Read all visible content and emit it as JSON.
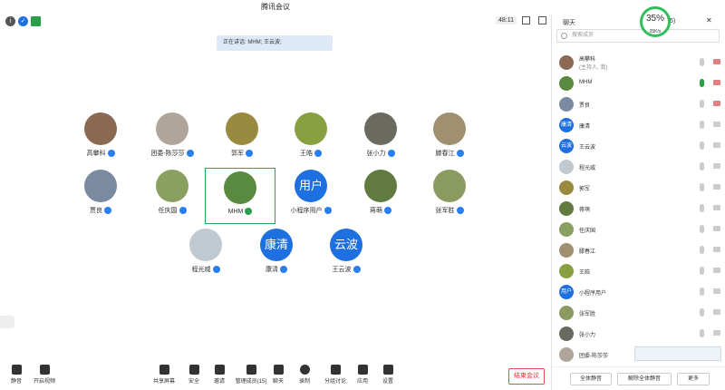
{
  "window": {
    "title": "腾讯会议",
    "timer": "48:11"
  },
  "speaking": "正在讲话: MHM; 王云波;",
  "participants_grid": [
    {
      "name": "高攀科",
      "avatar": "photo",
      "color": "#8a6a52"
    },
    {
      "name": "团委-陈莎莎",
      "avatar": "photo",
      "color": "#b0a59a"
    },
    {
      "name": "郭军",
      "avatar": "photo",
      "color": "#9a8a40"
    },
    {
      "name": "王皓",
      "avatar": "photo",
      "color": "#88a040"
    },
    {
      "name": "张小力",
      "avatar": "photo",
      "color": "#6a6a60"
    },
    {
      "name": "滕春江",
      "avatar": "photo",
      "color": "#a09070"
    },
    {
      "name": "贾良",
      "avatar": "photo",
      "color": "#7a8aa0"
    },
    {
      "name": "任庆国",
      "avatar": "photo",
      "color": "#8aa060"
    },
    {
      "name": "MHM",
      "avatar": "photo",
      "color": "#5a8a40"
    },
    {
      "name": "小程序用户",
      "avatar": "用户",
      "color": "#1e6fe0"
    },
    {
      "name": "蒋萌",
      "avatar": "photo",
      "color": "#607a40"
    },
    {
      "name": "张军胜",
      "avatar": "photo",
      "color": "#8a9a60"
    },
    {
      "name": "程光威",
      "avatar": "photo",
      "color": "#c0c8d0"
    },
    {
      "name": "康清",
      "avatar": "康清",
      "color": "#1e6fe0"
    },
    {
      "name": "王云波",
      "avatar": "云波",
      "color": "#1e6fe0"
    }
  ],
  "toolbar": {
    "mute": "静音",
    "video": "开启视频",
    "share": "共享屏幕",
    "security": "安全",
    "invite": "邀请",
    "members": "管理成员(15)",
    "chat": "聊天",
    "record": "录制",
    "breakout": "分组讨论",
    "apps": "应用",
    "settings": "设置",
    "end": "结束会议"
  },
  "panel": {
    "tab_chat": "聊天",
    "count": "5)",
    "search_placeholder": "搜索成员",
    "mute_all": "全体静音",
    "unmute_all": "解除全体静音",
    "more": "更多",
    "percent": "35%",
    "speed": "25K/s"
  },
  "member_list": [
    {
      "name": "高攀科",
      "sub": "(主持人, 我)",
      "avatar": "photo",
      "color": "#8a6a52"
    },
    {
      "name": "MHM",
      "avatar": "photo",
      "color": "#5a8a40"
    },
    {
      "name": "贾良",
      "avatar": "photo",
      "color": "#7a8aa0"
    },
    {
      "name": "康清",
      "avatar": "康清",
      "color": "#1e6fe0"
    },
    {
      "name": "王云波",
      "avatar": "云波",
      "color": "#1e6fe0"
    },
    {
      "name": "程光威",
      "avatar": "photo",
      "color": "#c0c8d0"
    },
    {
      "name": "郭军",
      "avatar": "photo",
      "color": "#9a8a40"
    },
    {
      "name": "蒋萌",
      "avatar": "photo",
      "color": "#607a40"
    },
    {
      "name": "任庆国",
      "avatar": "photo",
      "color": "#8aa060"
    },
    {
      "name": "滕春江",
      "avatar": "photo",
      "color": "#a09070"
    },
    {
      "name": "王皓",
      "avatar": "photo",
      "color": "#88a040"
    },
    {
      "name": "小程序用户",
      "avatar": "用户",
      "color": "#1e6fe0"
    },
    {
      "name": "张军胜",
      "avatar": "photo",
      "color": "#8a9a60"
    },
    {
      "name": "张小力",
      "avatar": "photo",
      "color": "#6a6a60"
    },
    {
      "name": "团委-陈莎莎",
      "avatar": "photo",
      "color": "#b0a59a"
    }
  ]
}
